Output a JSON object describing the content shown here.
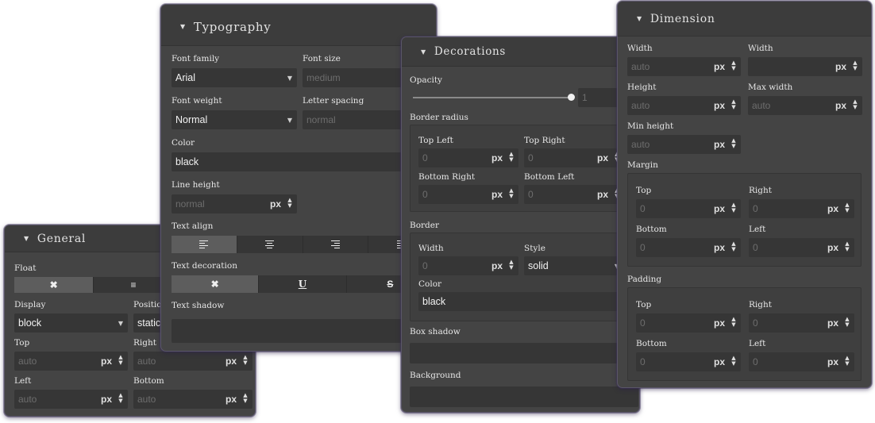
{
  "general": {
    "title": "General",
    "float_label": "Float",
    "float_options": [
      "✖",
      "≡"
    ],
    "display_label": "Display",
    "display_value": "block",
    "position_label": "Position",
    "position_value": "static",
    "top_label": "Top",
    "top_placeholder": "auto",
    "right_label": "Right",
    "right_placeholder": "auto",
    "left_label": "Left",
    "left_placeholder": "auto",
    "bottom_label": "Bottom",
    "bottom_placeholder": "auto",
    "unit": "px"
  },
  "typography": {
    "title": "Typography",
    "font_family_label": "Font family",
    "font_family_value": "Arial",
    "font_size_label": "Font size",
    "font_size_placeholder": "medium",
    "font_weight_label": "Font weight",
    "font_weight_value": "Normal",
    "letter_spacing_label": "Letter spacing",
    "letter_spacing_placeholder": "normal",
    "color_label": "Color",
    "color_value": "black",
    "line_height_label": "Line height",
    "line_height_placeholder": "normal",
    "unit": "px",
    "text_align_label": "Text align",
    "text_align_active_index": 0,
    "text_decoration_label": "Text decoration",
    "text_decoration_options": [
      "✖",
      "U",
      "S"
    ],
    "text_shadow_label": "Text shadow"
  },
  "decorations": {
    "title": "Decorations",
    "opacity_label": "Opacity",
    "opacity_value": "1",
    "opacity_level": 1,
    "border_radius_label": "Border radius",
    "top_left_label": "Top Left",
    "top_right_label": "Top Right",
    "bottom_right_label": "Bottom Right",
    "bottom_left_label": "Bottom Left",
    "radius_placeholder": "0",
    "border_label": "Border",
    "border_width_label": "Width",
    "border_width_placeholder": "0",
    "border_style_label": "Style",
    "border_style_value": "solid",
    "border_color_label": "Color",
    "border_color_value": "black",
    "box_shadow_label": "Box shadow",
    "background_label": "Background",
    "unit": "px"
  },
  "dimension": {
    "title": "Dimension",
    "width_label": "Width",
    "width_placeholder": "auto",
    "max_width_header_label": "Width",
    "height_label": "Height",
    "height_placeholder": "auto",
    "max_width_label": "Max width",
    "max_width_placeholder": "auto",
    "min_height_label": "Min height",
    "min_height_placeholder": "auto",
    "margin_label": "Margin",
    "padding_label": "Padding",
    "top_label": "Top",
    "right_label": "Right",
    "bottom_label": "Bottom",
    "left_label": "Left",
    "zero": "0",
    "unit": "px"
  },
  "colors": {
    "panel_bg": "#444444",
    "field_bg": "#363636",
    "border_color_swatch": "#000000"
  },
  "icons": {
    "caret": "caret-down-icon",
    "stepper": "stepper-arrows-icon",
    "dropdown": "dropdown-arrow-icon"
  }
}
